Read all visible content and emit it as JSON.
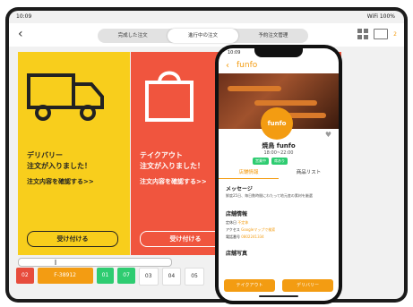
{
  "status_bar": {
    "time": "10:09",
    "sys": "WiFi 100%"
  },
  "topbar": {
    "back": "‹",
    "tabs": [
      "完成した注文",
      "進行中の注文",
      "予約注文管理"
    ],
    "badge": "2"
  },
  "cards": [
    {
      "title1": "デリバリー",
      "title2": "注文が入りました！",
      "link": "注文内容を確認する>>",
      "button": "受け付ける"
    },
    {
      "title1": "テイクアウト",
      "title2": "注文が入りました！",
      "link": "注文内容を確認する>>",
      "button": "受け付ける"
    }
  ],
  "chips": [
    "02",
    "F-38912",
    "01",
    "07",
    "03",
    "04",
    "05"
  ],
  "phone": {
    "time": "10:09",
    "back": "‹",
    "logo": "funfo",
    "logo_circle": "funfo",
    "shop_name": "焼鳥 funfo",
    "hours": "18:00~22:00",
    "tags": [
      "営業中",
      "席あり"
    ],
    "tabs": [
      "店舗情報",
      "商品リスト"
    ],
    "message_title": "メッセージ",
    "message": "鮮度25日、毎日数時間にわたって地元産の素材を厳選",
    "info_title": "店舗情報",
    "rows": [
      {
        "label": "定休日",
        "value": "不定休"
      },
      {
        "label": "アクセス",
        "value": "Googleマップで検索"
      },
      {
        "label": "電話番号",
        "value": "0802241334"
      }
    ],
    "photos_title": "店舗写真",
    "btn_takeout": "テイクアウト",
    "btn_delivery": "デリバリー"
  }
}
